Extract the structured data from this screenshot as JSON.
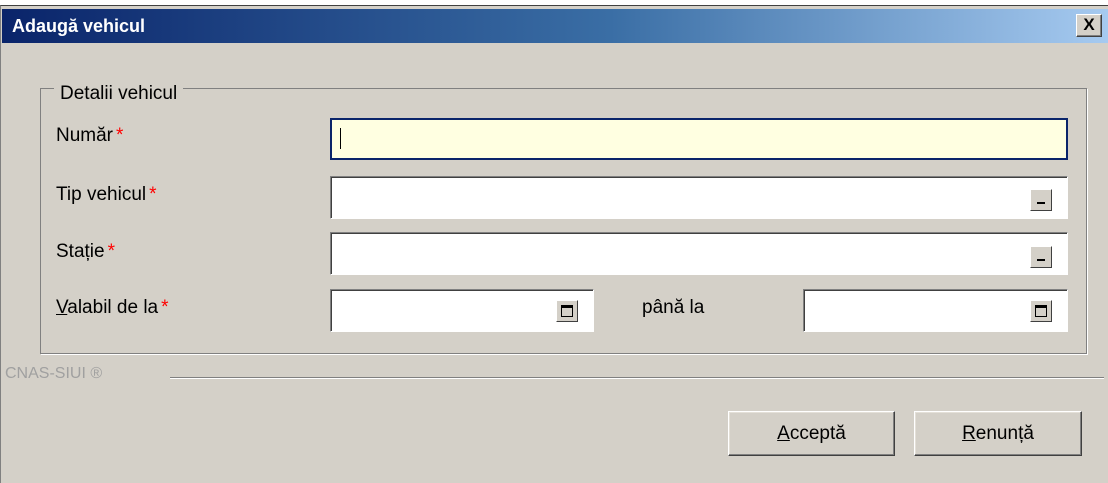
{
  "window": {
    "title": "Adaugă vehicul",
    "close_glyph": "X"
  },
  "group": {
    "legend": "Detalii vehicul",
    "fields": {
      "numar": {
        "label": "Număr",
        "value": "",
        "required": "*"
      },
      "tip_vehicul": {
        "label": "Tip vehicul",
        "value": "",
        "required": "*"
      },
      "statie": {
        "label": "Stație",
        "value": "",
        "required": "*"
      },
      "valabil_de_la": {
        "label_mnemonic": "V",
        "label_rest": "alabil de la",
        "value": "",
        "required": "*"
      },
      "pana_la": {
        "label": "până la",
        "value": ""
      }
    }
  },
  "footer": {
    "brand": "CNAS-SIUI ®"
  },
  "buttons": {
    "accept": {
      "mnemonic": "A",
      "rest": "cceptă"
    },
    "cancel": {
      "mnemonic": "R",
      "rest": "enunță"
    }
  },
  "icons": {
    "close": "close-icon",
    "lookup": "ellipsis-lookup-icon",
    "calendar": "calendar-icon"
  },
  "colors": {
    "title_start": "#0a246a",
    "title_end": "#a6caf0",
    "required": "#ff0000",
    "active_field": "#ffffe1",
    "dialog": "#d4d0c8"
  }
}
